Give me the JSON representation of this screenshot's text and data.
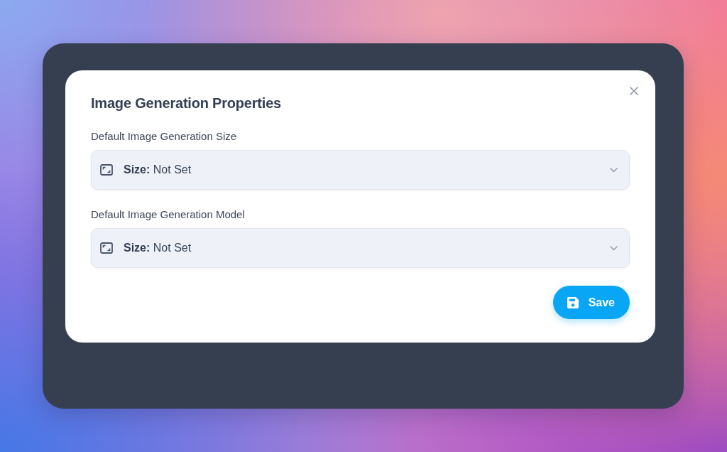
{
  "dialog": {
    "title": "Image Generation Properties",
    "fields": [
      {
        "label": "Default Image Generation Size",
        "value": "**Size:** Not Set"
      },
      {
        "label": "Default Image Generation Model",
        "value": "**Size:** Not Set"
      }
    ],
    "save_button": {
      "label": "Save"
    }
  }
}
